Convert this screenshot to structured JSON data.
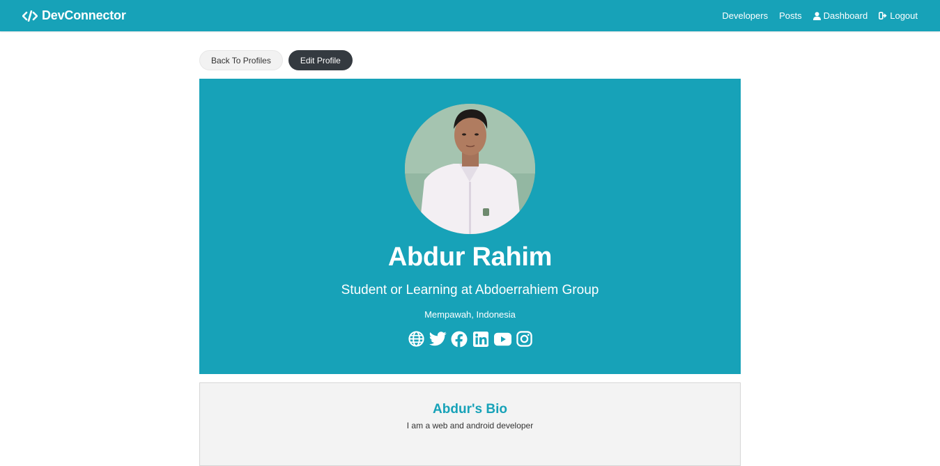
{
  "navbar": {
    "brand": "DevConnector",
    "links": {
      "developers": "Developers",
      "posts": "Posts",
      "dashboard": "Dashboard",
      "logout": "Logout"
    }
  },
  "actions": {
    "back": "Back To Profiles",
    "edit": "Edit Profile"
  },
  "profile": {
    "name": "Abdur Rahim",
    "title": "Student or Learning at Abdoerrahiem Group",
    "location": "Mempawah, Indonesia",
    "social_icons": [
      "globe-icon",
      "twitter-icon",
      "facebook-icon",
      "linkedin-icon",
      "youtube-icon",
      "instagram-icon"
    ]
  },
  "bio": {
    "title": "Abdur's Bio",
    "text": "I am a web and android developer"
  },
  "colors": {
    "primary": "#17a2b8",
    "dark": "#343a40",
    "light": "#f2f2f2"
  }
}
